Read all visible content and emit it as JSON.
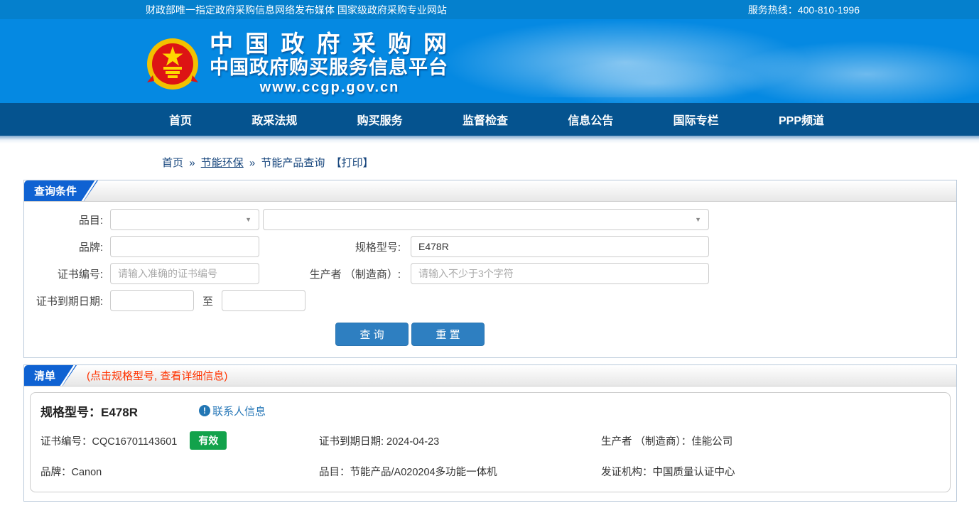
{
  "topbar": {
    "slogan": "财政部唯一指定政府采购信息网络发布媒体 国家级政府采购专业网站",
    "hotline": "服务热线：400-810-1996"
  },
  "banner": {
    "title": "中 国 政 府 采 购 网",
    "subtitle": "中国政府购买服务信息平台",
    "url": "www.ccgp.gov.cn"
  },
  "nav": {
    "items": [
      "首页",
      "政采法规",
      "购买服务",
      "监督检查",
      "信息公告",
      "国际专栏",
      "PPP频道"
    ]
  },
  "breadcrumb": {
    "home": "首页",
    "sep": "»",
    "section": "节能环保",
    "page": "节能产品查询",
    "print": "【打印】"
  },
  "query_panel": {
    "title": "查询条件",
    "fields": {
      "category_label": "品目:",
      "brand_label": "品牌:",
      "model_label": "规格型号:",
      "model_value": "E478R",
      "cert_no_label": "证书编号:",
      "cert_no_placeholder": "请输入准确的证书编号",
      "manufacturer_label": "生产者 （制造商）:",
      "manufacturer_placeholder": "请输入不少于3个字符",
      "expiry_label": "证书到期日期:",
      "to_label": "至",
      "select_arrow": "▼"
    },
    "buttons": {
      "search": "查 询",
      "reset": "重 置"
    }
  },
  "list_panel": {
    "title": "清单",
    "note": "(点击规格型号, 查看详细信息)",
    "result": {
      "model": "规格型号：E478R",
      "contact_icon": "!",
      "contact_link": "联系人信息",
      "cert_no": "证书编号：CQC16701143601",
      "status": "有效",
      "expiry": "证书到期日期: 2024-04-23",
      "manufacturer": "生产者 （制造商）：佳能公司",
      "brand": "品牌：Canon",
      "category": "品目：节能产品/A020204多功能一体机",
      "issuer": "发证机构：中国质量认证中心"
    }
  },
  "colors": {
    "topbar_bg": "#0580cd",
    "banner_bg": "#0589e2",
    "nav_bg": "#05538f",
    "tab_blue": "#0f62d2",
    "button_blue": "#2e7fc1",
    "badge_green": "#12a24b",
    "note_red": "#ff3300",
    "link_blue": "#2878b8"
  }
}
